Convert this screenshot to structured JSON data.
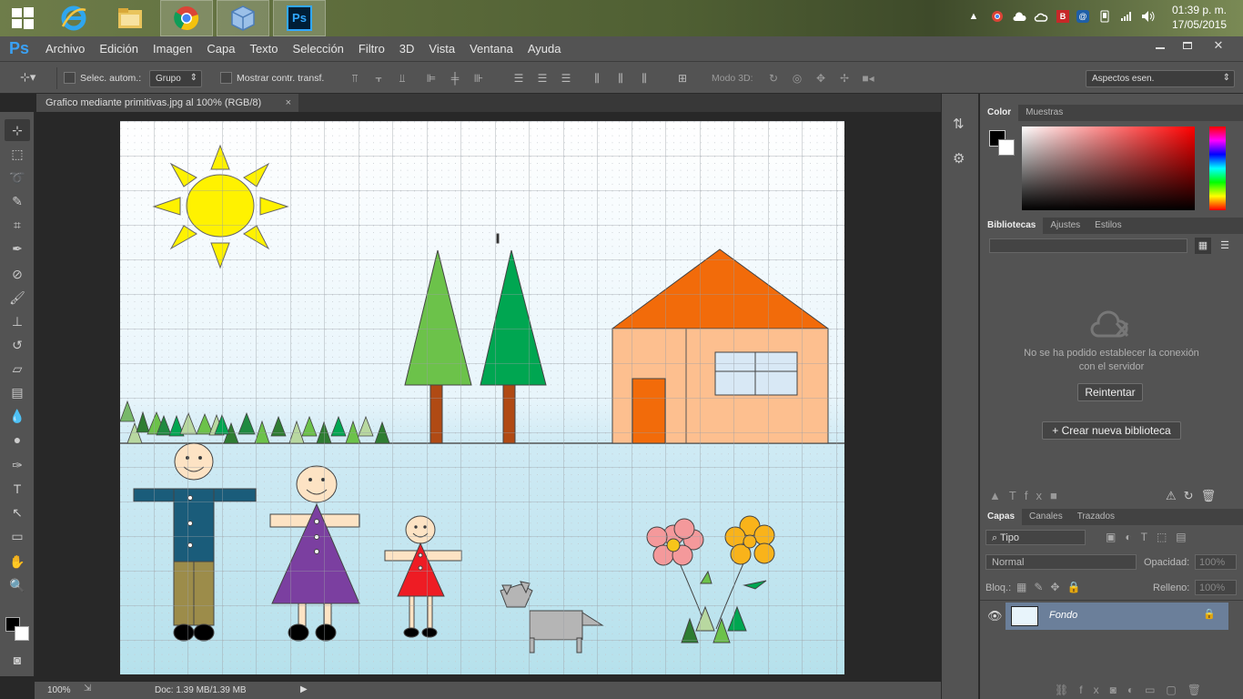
{
  "taskbar": {
    "clock_time": "01:39 p. m.",
    "clock_date": "17/05/2015",
    "apps": [
      "windows-start",
      "internet-explorer",
      "file-explorer",
      "chrome",
      "virtualbox",
      "photoshop"
    ],
    "photoshop_label": "Ps"
  },
  "app": {
    "logo": "Ps",
    "menu": [
      "Archivo",
      "Edición",
      "Imagen",
      "Capa",
      "Texto",
      "Selección",
      "Filtro",
      "3D",
      "Vista",
      "Ventana",
      "Ayuda"
    ]
  },
  "options": {
    "auto_select_label": "Selec. autom.:",
    "group_value": "Grupo",
    "show_transform_label": "Mostrar contr. transf.",
    "mode3d_label": "Modo 3D:",
    "workspace_value": "Aspectos esen."
  },
  "document": {
    "tab_title": "Grafico mediante primitivas.jpg al 100% (RGB/8)",
    "close_glyph": "×"
  },
  "status": {
    "zoom": "100%",
    "doc_info": "Doc: 1.39 MB/1.39 MB"
  },
  "color_panel": {
    "tabs": [
      "Color",
      "Muestras"
    ],
    "fg_color": "#000000",
    "bg_color": "#ffffff"
  },
  "libraries_panel": {
    "tabs": [
      "Bibliotecas",
      "Ajustes",
      "Estilos"
    ],
    "error_line1": "No se ha podido establecer la conexión",
    "error_line2": "con el servidor",
    "retry_label": "Reintentar",
    "create_label": "+ Crear nueva biblioteca"
  },
  "layers_panel": {
    "tabs": [
      "Capas",
      "Canales",
      "Trazados"
    ],
    "filter_value": "Tipo",
    "blend_mode": "Normal",
    "opacity_label": "Opacidad:",
    "opacity_value": "100%",
    "lock_label": "Bloq.:",
    "fill_label": "Relleno:",
    "fill_value": "100%",
    "layers": [
      {
        "name": "Fondo",
        "visible": true,
        "locked": true
      }
    ]
  }
}
